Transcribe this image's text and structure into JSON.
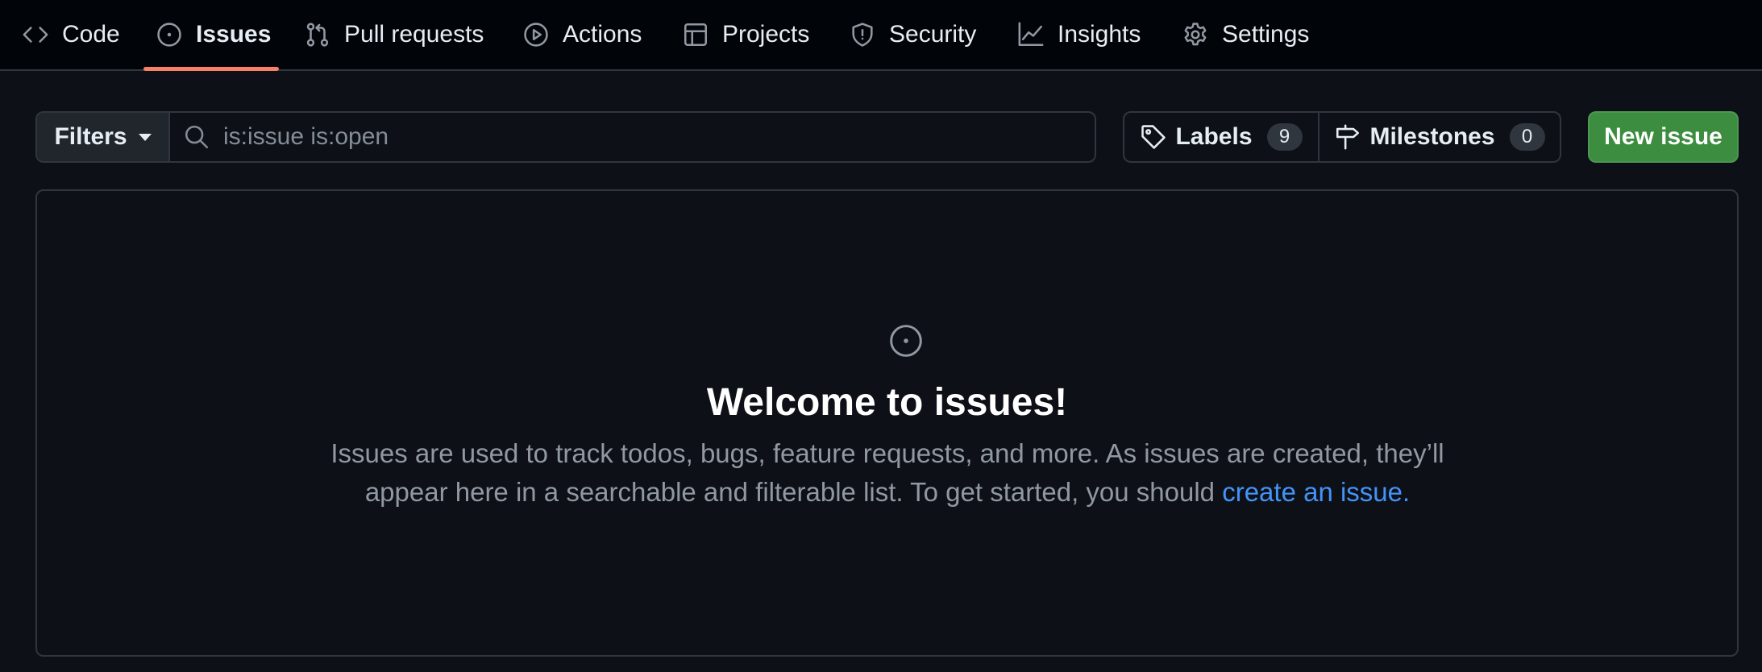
{
  "nav": {
    "tabs": [
      {
        "label": "Code",
        "icon": "code-icon",
        "active": false
      },
      {
        "label": "Issues",
        "icon": "issue-opened-icon",
        "active": true
      },
      {
        "label": "Pull requests",
        "icon": "git-pull-request-icon",
        "active": false
      },
      {
        "label": "Actions",
        "icon": "play-icon",
        "active": false
      },
      {
        "label": "Projects",
        "icon": "table-icon",
        "active": false
      },
      {
        "label": "Security",
        "icon": "shield-icon",
        "active": false
      },
      {
        "label": "Insights",
        "icon": "graph-icon",
        "active": false
      },
      {
        "label": "Settings",
        "icon": "gear-icon",
        "active": false
      }
    ],
    "active_indicator_color": "#f78166"
  },
  "toolbar": {
    "filters_label": "Filters",
    "search_placeholder": "is:issue is:open",
    "labels_label": "Labels",
    "labels_count": "9",
    "milestones_label": "Milestones",
    "milestones_count": "0",
    "new_issue_label": "New issue"
  },
  "blankslate": {
    "icon": "issue-opened-icon",
    "title": "Welcome to issues!",
    "description": "Issues are used to track todos, bugs, feature requests, and more. As issues are created, they’ll appear here in a searchable and filterable list. To get started, you should",
    "link_text": "create an issue."
  },
  "colors": {
    "background": "#0d1117",
    "header_background": "#010409",
    "border": "#30363d",
    "primary_button": "#3c8d40",
    "link": "#4493f8",
    "muted_text": "#9198a1"
  }
}
